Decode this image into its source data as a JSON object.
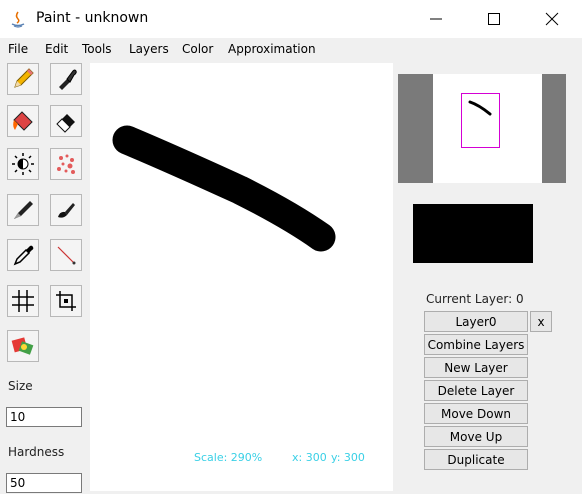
{
  "window": {
    "title": "Paint - unknown",
    "minimize_label": "minimize",
    "maximize_label": "maximize",
    "close_label": "close"
  },
  "menu": [
    "File",
    "Edit",
    "Tools",
    "Layers",
    "Color",
    "Approximation"
  ],
  "tools": [
    {
      "name": "pencil-icon"
    },
    {
      "name": "eyedropper-brush-icon"
    },
    {
      "name": "paint-bucket-icon"
    },
    {
      "name": "eraser-icon"
    },
    {
      "name": "brightness-icon"
    },
    {
      "name": "spray-icon"
    },
    {
      "name": "brush-icon"
    },
    {
      "name": "smudge-icon"
    },
    {
      "name": "color-picker-icon"
    },
    {
      "name": "line-icon"
    },
    {
      "name": "grid-icon"
    },
    {
      "name": "crop-icon"
    },
    {
      "name": "shapes-icon"
    }
  ],
  "size": {
    "label": "Size",
    "value": "10"
  },
  "hardness": {
    "label": "Hardness",
    "value": "50"
  },
  "status": {
    "scale": "Scale: 290%",
    "x": "x: 300",
    "y": "y: 300"
  },
  "colors": {
    "current_color": "#000000",
    "preview_view_border": "#d400d4",
    "status_text": "#3ad0e6"
  },
  "layers": {
    "current_layer_label": "Current Layer: 0",
    "layer_button": "Layer0",
    "remove_button": "x",
    "combine": "Combine Layers",
    "new": "New Layer",
    "delete": "Delete Layer",
    "move_down": "Move Down",
    "move_up": "Move Up",
    "duplicate": "Duplicate"
  }
}
